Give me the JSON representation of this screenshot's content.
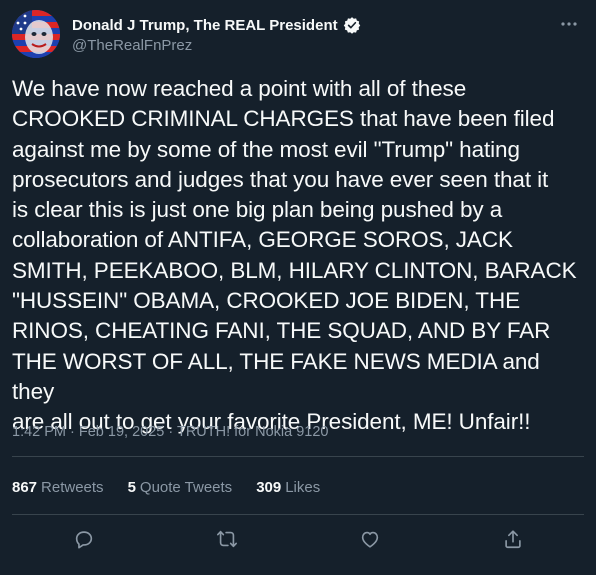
{
  "author": {
    "display_name": "Donald J Trump, The REAL President",
    "handle": "@TheRealFnPrez",
    "avatar_icon": "flag-face-avatar",
    "verified_icon": "verified-badge-icon"
  },
  "tweet": {
    "text": "We have now reached a point with all of these\nCROOKED CRIMINAL CHARGES that have been filed\nagainst me by some of the most evil \"Trump\" hating\nprosecutors and judges that you have ever seen that it\nis clear this is just one big plan being pushed by a\ncollaboration of ANTIFA, GEORGE SOROS, JACK\nSMITH, PEEKABOO, BLM, HILARY CLINTON, BARACK\n\"HUSSEIN\" OBAMA, CROOKED JOE BIDEN, THE\nRINOS, CHEATING FANI, THE SQUAD, AND BY FAR\nTHE WORST OF ALL, THE FAKE NEWS MEDIA and they\nare all out to get your favorite President, ME! Unfair!!",
    "meta": "1:42 PM · Feb 19, 2025 · TRUTH! for Nokia 9120"
  },
  "stats": {
    "retweets_count": "867",
    "retweets_label": "Retweets",
    "quotes_count": "5",
    "quotes_label": "Quote Tweets",
    "likes_count": "309",
    "likes_label": "Likes"
  },
  "actions": [
    "reply-icon",
    "retweet-icon",
    "like-icon",
    "share-icon"
  ],
  "colors": {
    "background": "#15202b",
    "text_primary": "#f7f9f9",
    "text_secondary": "#8b98a5",
    "divider": "#38444d"
  }
}
